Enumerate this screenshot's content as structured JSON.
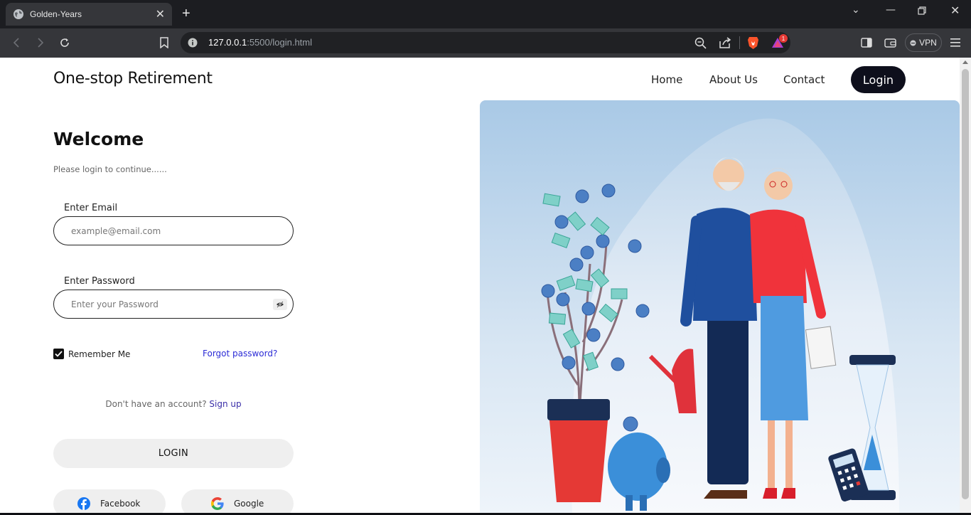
{
  "browser": {
    "tab_title": "Golden-Years",
    "url_host": "127.0.0.1",
    "url_path": ":5500/login.html",
    "vpn_label": "VPN",
    "notification_count": "1"
  },
  "header": {
    "brand": "One-stop Retirement",
    "nav": {
      "home": "Home",
      "about": "About Us",
      "contact": "Contact",
      "login": "Login"
    }
  },
  "form": {
    "title": "Welcome",
    "subtitle": "Please login to continue......",
    "email_label": "Enter Email",
    "email_placeholder": "example@email.com",
    "password_label": "Enter Password",
    "password_placeholder": "Enter your Password",
    "remember_label": "Remember Me",
    "remember_checked": true,
    "forgot_label": "Forgot password?",
    "no_account_text": "Don't have an account?",
    "signup_label": "Sign up",
    "login_button": "LOGIN",
    "facebook_label": "Facebook",
    "google_label": "Google"
  },
  "colors": {
    "nav_login_bg": "#0e0f1c",
    "link_color": "#2b2bd6",
    "hero_bg_top": "#a9c9e6",
    "hero_bg_bottom": "#eef4fa"
  },
  "icons": [
    "globe-icon",
    "close-icon",
    "plus-icon",
    "back-icon",
    "forward-icon",
    "reload-icon",
    "bookmark-icon",
    "info-icon",
    "zoom-icon",
    "share-icon",
    "brave-icon",
    "rewards-icon",
    "sidebar-icon",
    "wallet-icon",
    "menu-icon",
    "eye-off-icon",
    "check-icon",
    "facebook-icon",
    "google-icon"
  ]
}
